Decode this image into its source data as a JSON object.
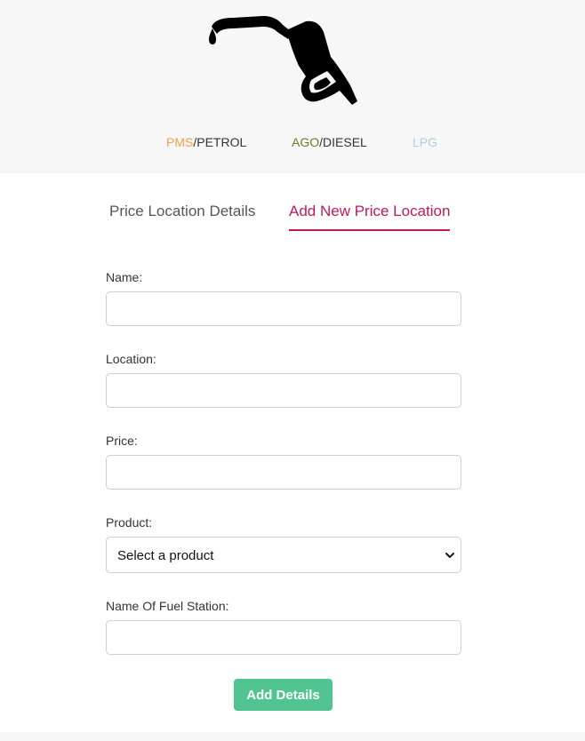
{
  "colors": {
    "header_bg": "#f7f7f7",
    "pms": "#f0a04b",
    "ago": "#6b7a2e",
    "lpg": "#a7d3e0",
    "accent": "#c2185b",
    "button": "#52c491"
  },
  "header": {
    "logo_icon": "fuel-pump-nozzle-icon",
    "fuels": [
      {
        "code": "PMS",
        "name": "/PETROL"
      },
      {
        "code": "AGO",
        "name": "/DIESEL"
      },
      {
        "code": "LPG",
        "name": ""
      }
    ]
  },
  "tabs": [
    {
      "label": "Price Location Details",
      "active": false
    },
    {
      "label": "Add New Price Location",
      "active": true
    }
  ],
  "form": {
    "name": {
      "label": "Name:",
      "value": ""
    },
    "location": {
      "label": "Location:",
      "value": ""
    },
    "price": {
      "label": "Price:",
      "value": ""
    },
    "product": {
      "label": "Product:",
      "selected": "Select a product"
    },
    "station": {
      "label": "Name Of Fuel Station:",
      "value": ""
    },
    "submit_label": "Add Details"
  }
}
